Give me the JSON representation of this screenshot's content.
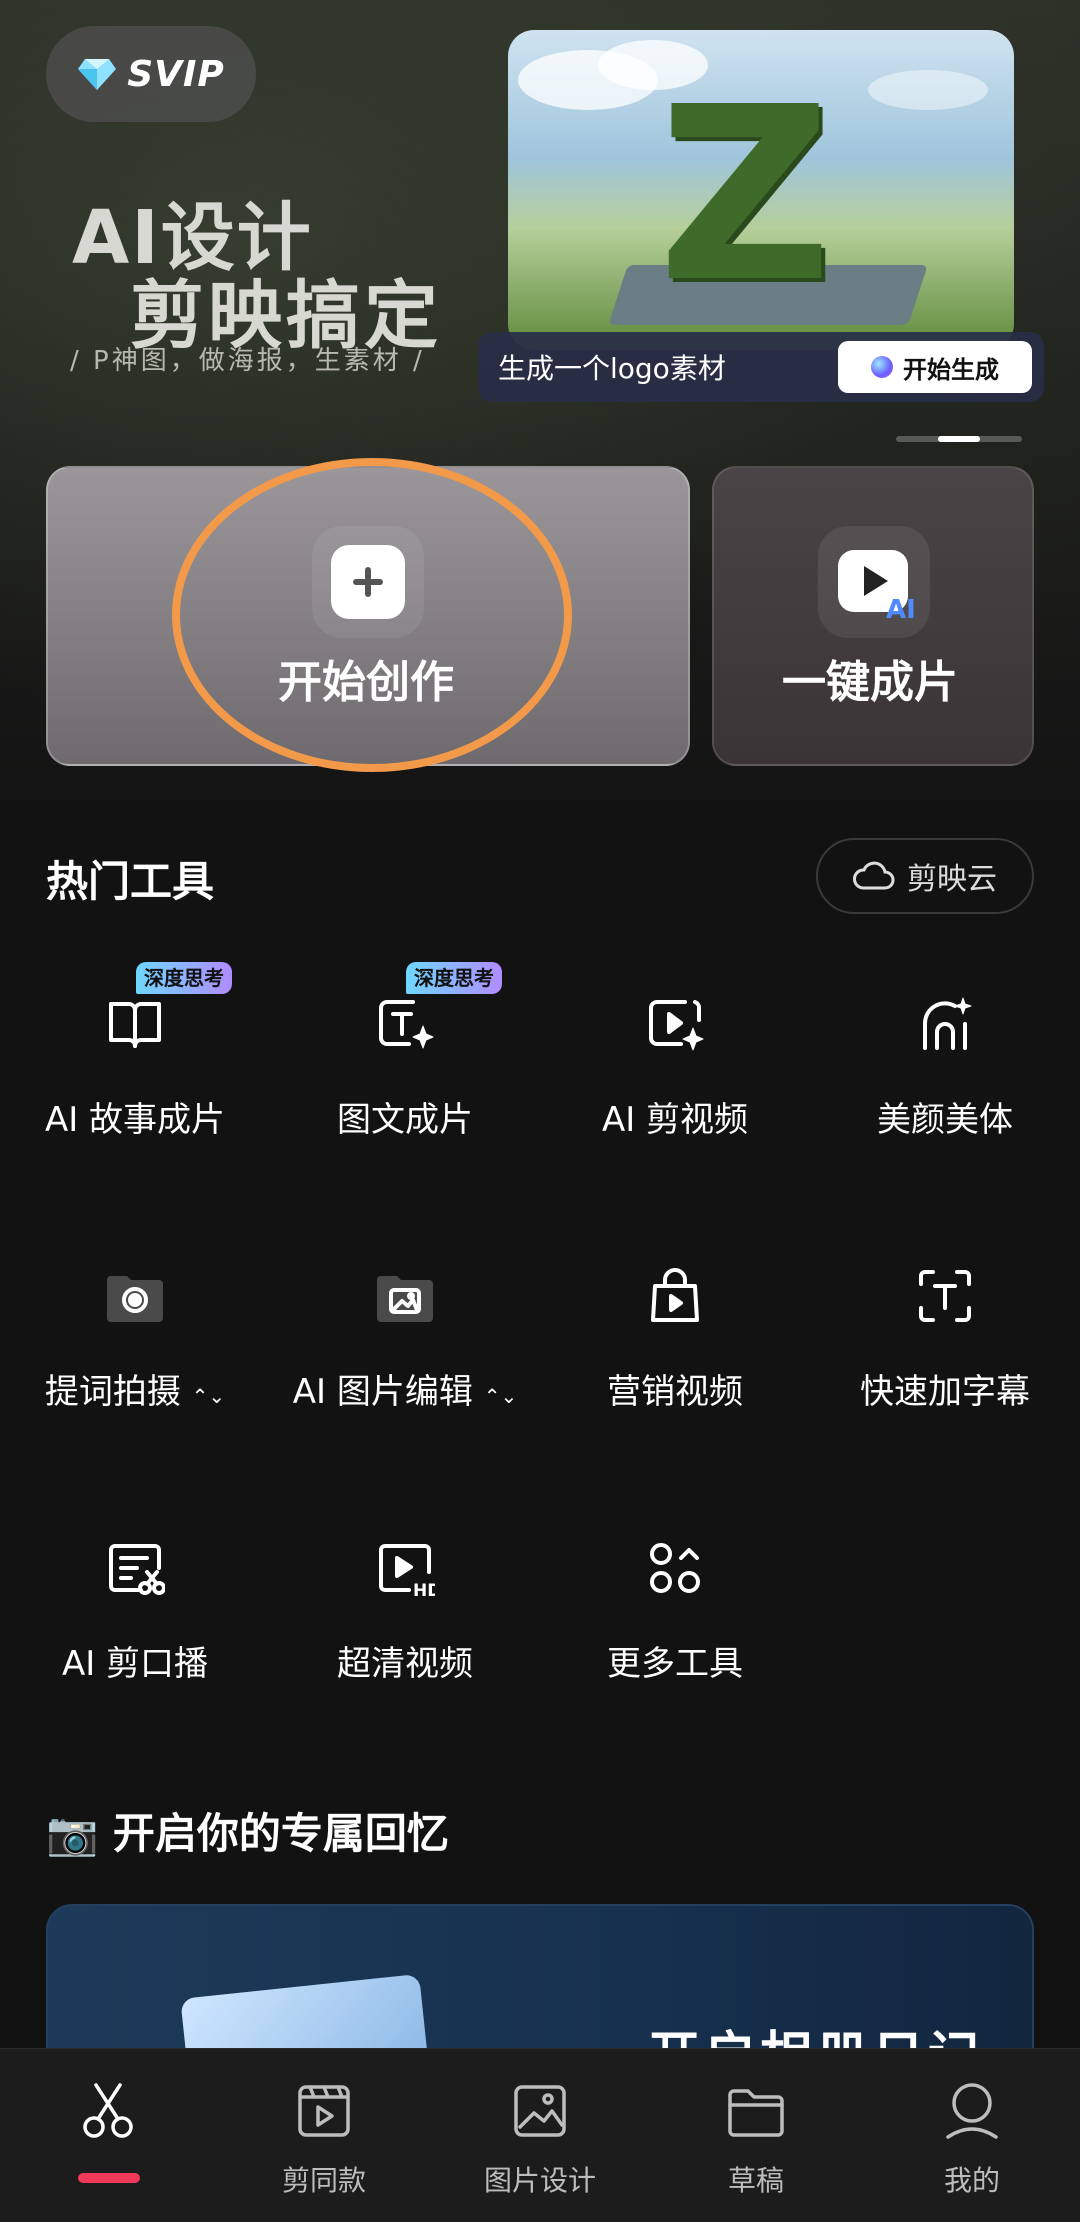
{
  "hero": {
    "svip_label": "SVIP",
    "title_line1": "AI设计",
    "title_line2": "剪映搞定",
    "subtitle": "/  P神图，做海报，生素材  /",
    "promo_prompt": "生成一个logo素材",
    "promo_button": "开始生成",
    "carousel": {
      "count": 3,
      "active_index": 1
    }
  },
  "actions": {
    "start_create": "开始创作",
    "one_click": "一键成片",
    "ai_badge": "AI"
  },
  "hot_tools": {
    "title": "热门工具",
    "cloud_button": "剪映云",
    "items": [
      {
        "label": "AI 故事成片",
        "icon": "book-icon",
        "badge": "深度思考"
      },
      {
        "label": "图文成片",
        "icon": "text-sparkle-icon",
        "badge": "深度思考"
      },
      {
        "label": "AI 剪视频",
        "icon": "video-sparkle-icon"
      },
      {
        "label": "美颜美体",
        "icon": "face-sparkle-icon"
      },
      {
        "label": "提词拍摄",
        "icon": "camera-folder-icon",
        "expand": "⌃⌄"
      },
      {
        "label": "AI 图片编辑",
        "icon": "image-folder-icon",
        "expand": "⌃⌄"
      },
      {
        "label": "营销视频",
        "icon": "shopping-bag-icon"
      },
      {
        "label": "快速加字幕",
        "icon": "caption-icon"
      },
      {
        "label": "AI 剪口播",
        "icon": "script-cut-icon"
      },
      {
        "label": "超清视频",
        "icon": "hd-video-icon"
      },
      {
        "label": "更多工具",
        "icon": "more-tools-icon"
      }
    ]
  },
  "memory": {
    "title_emoji": "📷",
    "title": "开启你的专属回忆",
    "banner_text": "开启相册日记"
  },
  "bottom_nav": {
    "items": [
      {
        "label": "",
        "icon": "scissors-icon",
        "active": true
      },
      {
        "label": "剪同款",
        "icon": "template-icon"
      },
      {
        "label": "图片设计",
        "icon": "image-icon"
      },
      {
        "label": "草稿",
        "icon": "folder-icon"
      },
      {
        "label": "我的",
        "icon": "profile-icon"
      }
    ]
  },
  "colors": {
    "accent_orange": "#f29a4a",
    "nav_indicator": "#f0385a",
    "badge_gradient_start": "#6fd7ff",
    "badge_gradient_end": "#b08cff"
  }
}
